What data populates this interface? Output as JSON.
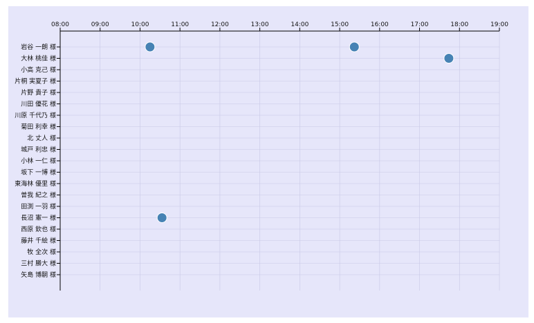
{
  "chart_data": {
    "type": "scatter",
    "x_ticks": [
      "08:00",
      "09:00",
      "10:00",
      "11:00",
      "12:00",
      "13:00",
      "14:00",
      "15:00",
      "16:00",
      "17:00",
      "18:00",
      "19:00"
    ],
    "xlim": [
      "08:00",
      "19:00"
    ],
    "axis_position": "top",
    "grid": true,
    "rows": [
      "岩谷 一朗 様",
      "大林 桃佳 様",
      "小高 克己 様",
      "片桐 実夏子 様",
      "片野 貴子 様",
      "川田 優花 様",
      "川原 千代乃 様",
      "菊田 利幸 様",
      "北 丈人 様",
      "城戸 利忠 様",
      "小林 一仁 様",
      "坂下 一博 様",
      "東海林 優里 様",
      "曽我 紀之 様",
      "田渕 一羽 様",
      "長沼 憲一 様",
      "西原 欽也 様",
      "藤井 千絵 様",
      "牧 全次 様",
      "三村 勝大 様",
      "矢島 博嗣 様"
    ],
    "points": [
      {
        "row": "岩谷 一朗 様",
        "time": "10:15"
      },
      {
        "row": "岩谷 一朗 様",
        "time": "15:22"
      },
      {
        "row": "大林 桃佳 様",
        "time": "17:44"
      },
      {
        "row": "長沼 憲一 様",
        "time": "10:33"
      }
    ],
    "colors": {
      "background": "#e6e6fa",
      "point": "#4682b4",
      "grid": "#c8c8e6"
    }
  }
}
